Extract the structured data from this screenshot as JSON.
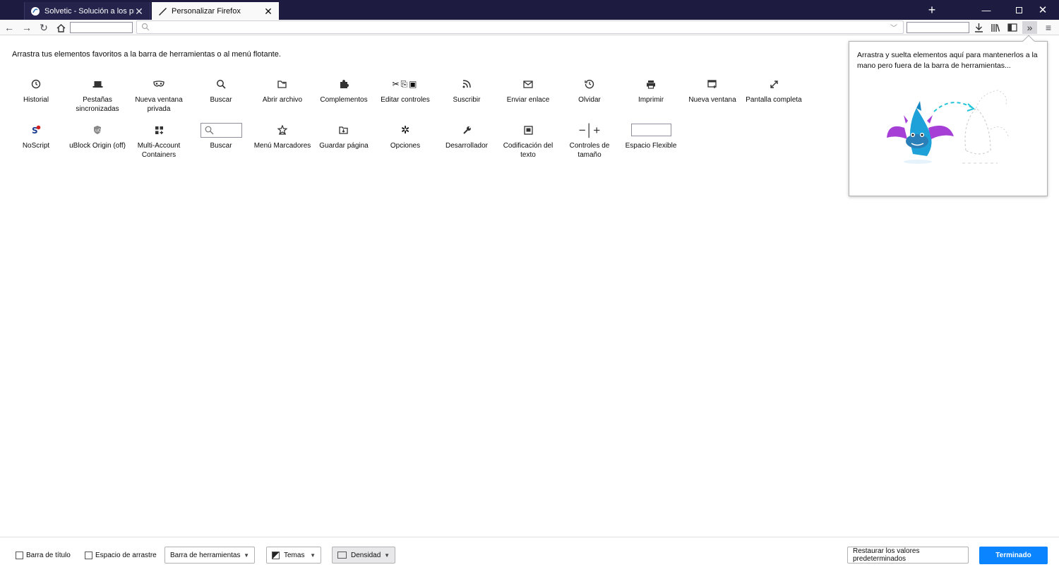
{
  "tabs": [
    {
      "label": "Solvetic - Solución a los proble",
      "active": false
    },
    {
      "label": "Personalizar Firefox",
      "active": true
    }
  ],
  "palette": {
    "hint": "Arrastra tus elementos favoritos a la barra de herramientas o al menú flotante.",
    "row1": [
      {
        "icon": "clock-icon",
        "label": "Historial"
      },
      {
        "icon": "laptop-icon",
        "label": "Pestañas sincronizadas"
      },
      {
        "icon": "mask-icon",
        "label": "Nueva ventana privada"
      },
      {
        "icon": "search-icon",
        "label": "Buscar"
      },
      {
        "icon": "folder-open-icon",
        "label": "Abrir archivo"
      },
      {
        "icon": "puzzle-icon",
        "label": "Complementos"
      },
      {
        "icon": "edit-controls-icon",
        "label": "Editar controles"
      },
      {
        "icon": "rss-icon",
        "label": "Suscribir"
      },
      {
        "icon": "mail-icon",
        "label": "Enviar enlace"
      },
      {
        "icon": "forget-icon",
        "label": "Olvidar"
      },
      {
        "icon": "printer-icon",
        "label": "Imprimir"
      },
      {
        "icon": "new-window-icon",
        "label": "Nueva ventana"
      },
      {
        "icon": "fullscreen-icon",
        "label": "Pantalla completa"
      }
    ],
    "row2": [
      {
        "icon": "noscript-icon",
        "label": "NoScript"
      },
      {
        "icon": "ublock-icon",
        "label": "uBlock Origin (off)"
      },
      {
        "icon": "containers-icon",
        "label": "Multi-Account Containers"
      },
      {
        "icon": "search-box-icon",
        "label": "Buscar"
      },
      {
        "icon": "bookmark-star-icon",
        "label": "Menú Marcadores"
      },
      {
        "icon": "save-page-icon",
        "label": "Guardar página"
      },
      {
        "icon": "gear-icon",
        "label": "Opciones"
      },
      {
        "icon": "wrench-icon",
        "label": "Desarrollador"
      },
      {
        "icon": "text-encoding-icon",
        "label": "Codificación del texto"
      },
      {
        "icon": "zoom-controls-icon",
        "label": "Controles de tamaño"
      },
      {
        "icon": "flexible-space-icon",
        "label": "Espacio Flexible"
      }
    ]
  },
  "overflow_panel": {
    "text": "Arrastra y suelta elementos aquí para mantenerlos a la mano pero fuera de la barra de herramientas..."
  },
  "bottom": {
    "title_bar_label": "Barra de título",
    "drag_space_label": "Espacio de arrastre",
    "toolbars_label": "Barra de herramientas",
    "themes_label": "Temas",
    "density_label": "Densidad",
    "restore_label": "Restaurar los valores predeterminados",
    "done_label": "Terminado"
  }
}
